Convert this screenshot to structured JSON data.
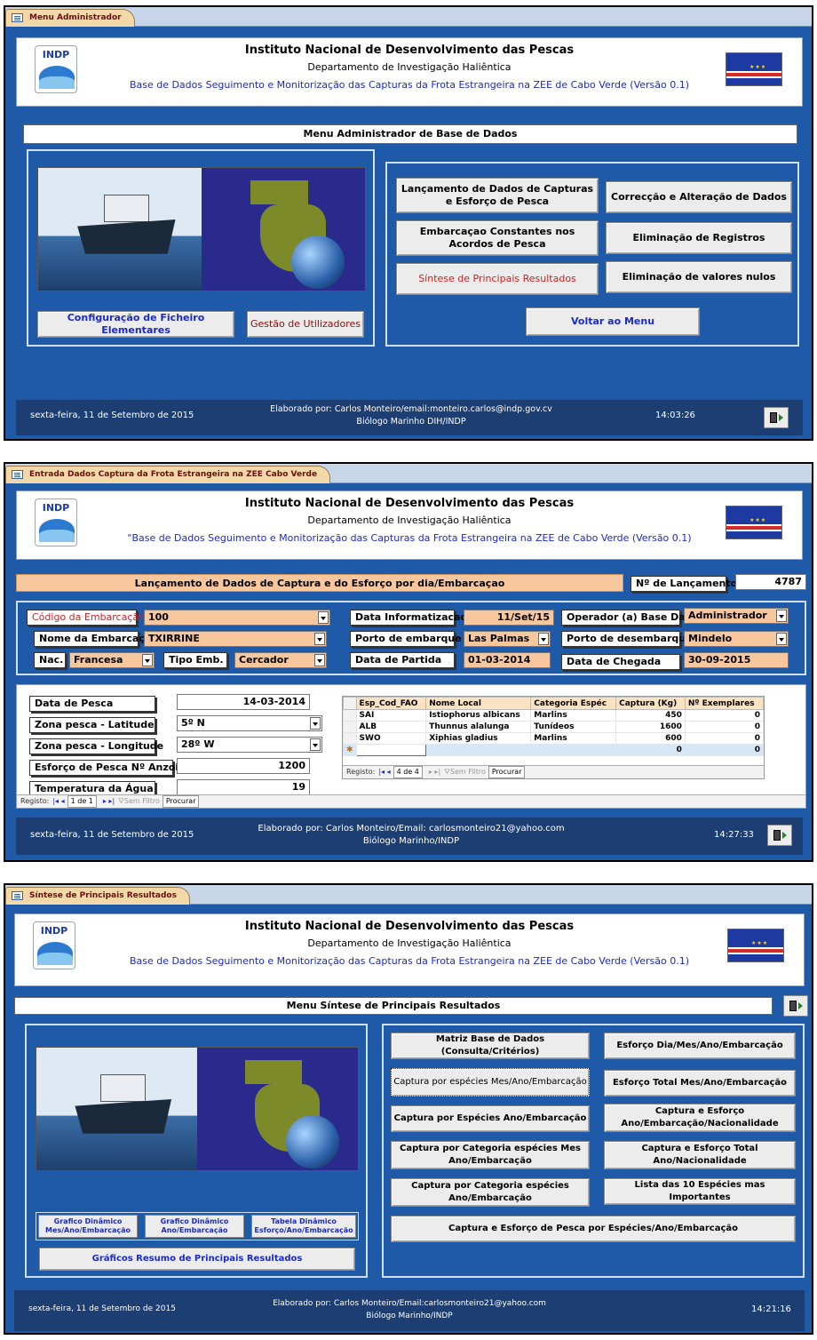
{
  "colors": {
    "screen_bg": "#1f5aa8",
    "footer_bg": "#1c3e72",
    "field_bg": "#f9c79e",
    "accent_blue": "#1a2ad0",
    "accent_red": "#d42020"
  },
  "header": {
    "institute": "Instituto Nacional de Desenvolvimento das Pescas",
    "department": "Departamento de Investigação Haliêntica",
    "database": "Base de Dados Seguimento e Monitorização das Capturas da Frota Estrangeira na ZEE de Cabo Verde (Versão 0.1)",
    "database_quoted": "\"Base de Dados Seguimento e Monitorização das Capturas da Frota Estrangeira na ZEE de Cabo Verde (Versão 0.1)",
    "logo_text": "INDP"
  },
  "screen1": {
    "tab": "Menu Administrador",
    "title": "Menu Administrador de Base de Dados",
    "buttons": {
      "lancamento": "Lançamento de Dados de Capturas e Esforço de Pesca",
      "correccao": "Correcção  e Alteração de Dados",
      "embarcacao": "Embarcaçao Constantes nos Acordos de Pesca",
      "eliminacao_registros": "Eliminação de Registros",
      "sintese": "Síntese de Principais Resultados",
      "eliminacao_nulos": "Eliminação de valores nulos",
      "voltar": "Voltar ao Menu",
      "configuracao": "Configuração de Ficheiro Elementares",
      "gestao": "Gestão de Utilizadores"
    },
    "footer": {
      "date": "sexta-feira, 11 de Setembro de 2015",
      "credit1": "Elaborado por: Carlos Monteiro/email:monteiro.carlos@indp.gov.cv",
      "credit2": "Biólogo Marinho DIH/INDP",
      "time": "14:03:26"
    }
  },
  "screen2": {
    "tab": "Entrada Dados Captura da Frota Estrangeira na ZEE Cabo Verde",
    "title": "Lançamento de Dados de Captura e do Esforço por dia/Embarcaçao",
    "n_lancamento_label": "Nº de Lançamento",
    "n_lancamento": "4787",
    "fields": {
      "codigo_label": "Código da Embarcação",
      "codigo": "100",
      "nome_label": "Nome da Embarcação",
      "nome": "TXIRRINE",
      "nac_label": "Nac.",
      "nac": "Francesa",
      "tipo_label": "Tipo Emb.",
      "tipo": "Cercador",
      "data_inf_label": "Data Informatizacao",
      "data_inf": "11/Set/15",
      "operador_label": "Operador (a) Base Dados",
      "operador": "Administrador",
      "porto_emb_label": "Porto de embarque",
      "porto_emb": "Las Palmas",
      "porto_des_label": "Porto de desembarque",
      "porto_des": "Mindelo",
      "partida_label": "Data de Partida",
      "partida": "01-03-2014",
      "chegada_label": "Data de Chegada",
      "chegada": "30-09-2015"
    },
    "pesca": {
      "data_label": "Data de Pesca",
      "data": "14-03-2014",
      "lat_label": "Zona pesca - Latitude",
      "lat": "5º N",
      "lon_label": "Zona pesca - Longitude",
      "lon": "28º W",
      "esforco_label": "Esforço de Pesca Nº Anzois",
      "esforco": "1200",
      "temp_label": "Temperatura da Água",
      "temp": "19"
    },
    "table": {
      "headers": [
        "Esp_Cod_FAO",
        "Nome Local",
        "Categoria Espéc",
        "Captura (Kg)",
        "Nº Exemplares"
      ],
      "rows": [
        [
          "SAI",
          "Istiophorus albicans",
          "Marlins",
          "450",
          "0"
        ],
        [
          "ALB",
          "Thunnus alalunga",
          "Tunídeos",
          "1600",
          "0"
        ],
        [
          "SWO",
          "Xiphias gladius",
          "Marlins",
          "600",
          "0"
        ]
      ],
      "new_row": [
        "",
        "",
        "",
        "0",
        "0"
      ]
    },
    "nav_sub": {
      "label": "Registo:",
      "pos": "4 de 4",
      "filter": "Sem Filtro",
      "search": "Procurar"
    },
    "nav_main": {
      "label": "Registo:",
      "pos": "1 de 1",
      "filter": "Sem Filtro",
      "search": "Procurar"
    },
    "footer": {
      "date": "sexta-feira, 11 de Setembro de 2015",
      "credit1": "Elaborado por: Carlos Monteiro/Email: carlosmonteiro21@yahoo.com",
      "credit2": "Biólogo Marinho/INDP",
      "time": "14:27:33"
    }
  },
  "screen3": {
    "tab": "Síntese de Principais Resultados",
    "title": "Menu Síntese de Principais Resultados",
    "buttons": {
      "matriz": "Matriz Base de Dados (Consulta/Critérios)",
      "esforco_dia": "Esforço Dia/Mes/Ano/Embarcação",
      "captura_especies_mes": "Captura por espécies Mes/Ano/Embarcação",
      "esforco_total": "Esforço Total Mes/Ano/Embarcação",
      "captura_especies_ano": "Captura por Espécies  Ano/Embarcação",
      "captura_esforco_nac": "Captura e Esforço Ano/Embarcação/Nacionalidade",
      "captura_cat_mes": "Captura por Categoria espécies Mes Ano/Embarcação",
      "captura_esforco_total": "Captura e Esforço Total Ano/Nacionalidade",
      "captura_cat_ano": "Captura por Categoria espécies Ano/Embarcação",
      "lista_10": "Lista das 10 Espécies mas Importantes",
      "captura_esforco_especies": "Captura e Esforço de Pesca por Espécies/Ano/Embarcação",
      "grafico_mes": "Grafico Dinâmico Mes/Ano/Embarcação",
      "grafico_ano": "Grafico Dinâmico Ano/Embarcação",
      "tabela": "Tabela Dinâmico Esforço/Ano/Embarcação",
      "graficos_resumo": "Gráficos Resumo de Principais Resultados"
    },
    "footer": {
      "date": "sexta-feira, 11 de Setembro de 2015",
      "credit1": "Elaborado por: Carlos Monteiro/Email:carlosmonteiro21@yahoo.com",
      "credit2": "Biólogo Marinho/INDP",
      "time": "14:21:16"
    }
  }
}
